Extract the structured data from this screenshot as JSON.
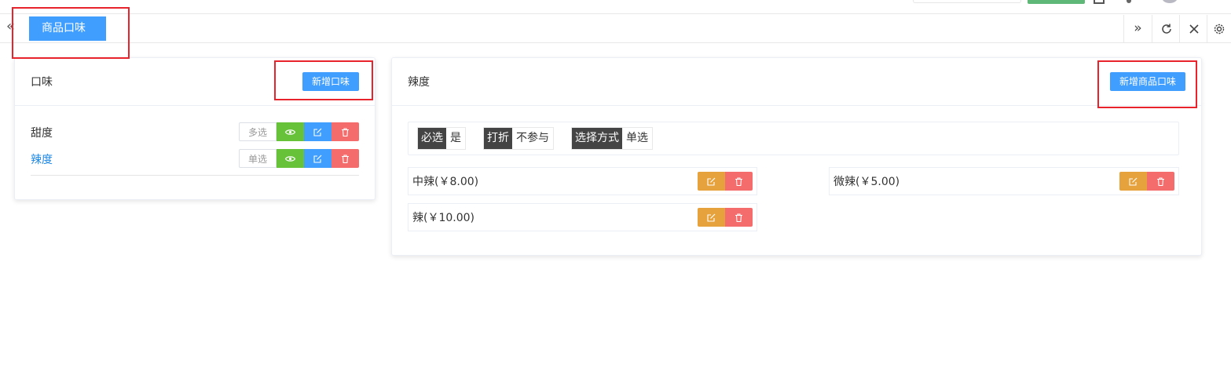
{
  "tabs": {
    "active_label": "商品口味"
  },
  "left_panel": {
    "title": "口味",
    "add_button": "新增口味",
    "rows": [
      {
        "label": "甜度",
        "mode": "多选",
        "selected": false
      },
      {
        "label": "辣度",
        "mode": "单选",
        "selected": true
      }
    ]
  },
  "right_panel": {
    "title": "辣度",
    "add_button": "新增商品口味",
    "props": [
      {
        "key": "必选",
        "value": "是"
      },
      {
        "key": "打折",
        "value": "不参与"
      },
      {
        "key": "选择方式",
        "value": "单选"
      }
    ],
    "options": [
      {
        "label": "中辣(￥8.00)"
      },
      {
        "label": "微辣(￥5.00)"
      },
      {
        "label": "辣(￥10.00)"
      }
    ]
  },
  "icons": {
    "view": "eye-icon",
    "edit": "edit-icon",
    "delete": "trash-icon"
  },
  "colors": {
    "primary": "#409eff",
    "success": "#67c23a",
    "danger": "#f56c6c",
    "warning": "#e6a23c",
    "highlight": "#e8232b",
    "link": "#1e88e5"
  }
}
